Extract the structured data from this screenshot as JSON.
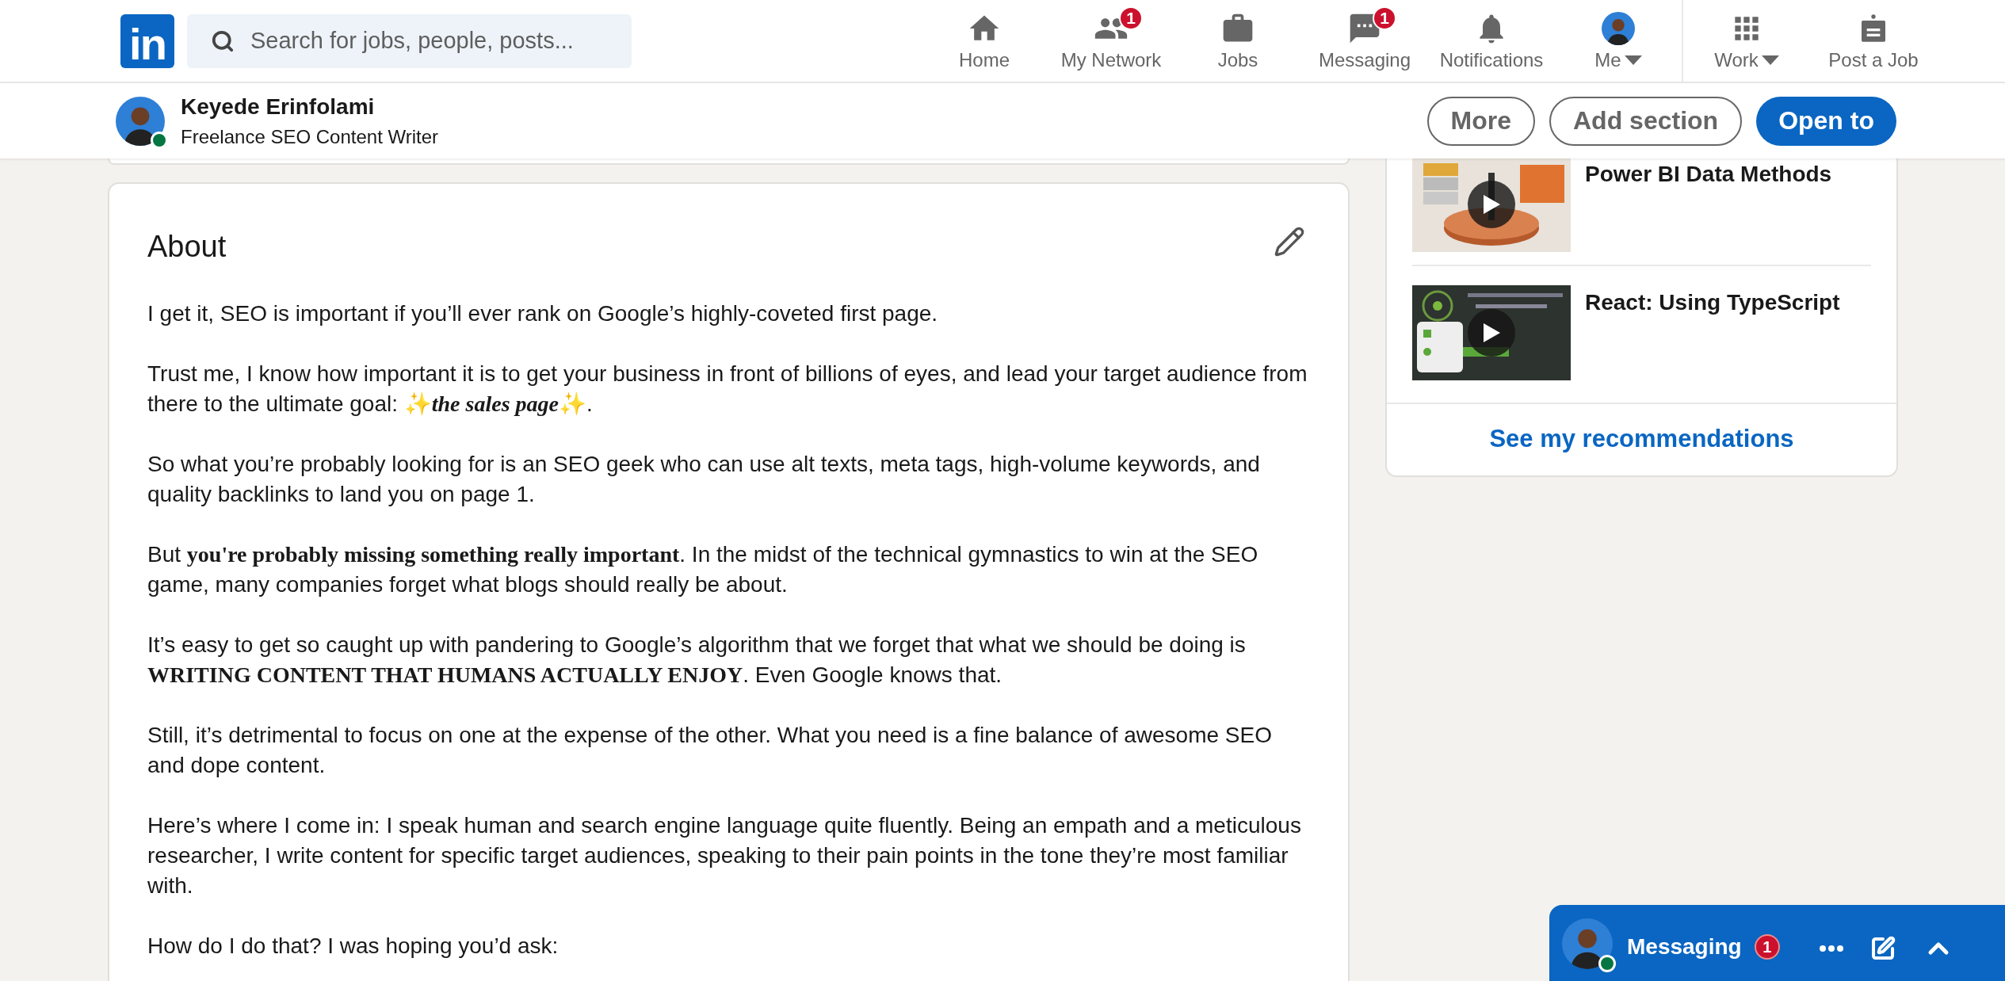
{
  "nav": {
    "logo": "in",
    "search": {
      "placeholder": "Search for jobs, people, posts..."
    },
    "items": [
      {
        "kind": "home",
        "label": "Home",
        "dropdown": false
      },
      {
        "kind": "network",
        "label": "My Network",
        "badge": "1",
        "dropdown": false
      },
      {
        "kind": "jobs",
        "label": "Jobs",
        "dropdown": false
      },
      {
        "kind": "messaging",
        "label": "Messaging",
        "badge": "1",
        "dropdown": false
      },
      {
        "kind": "notifications",
        "label": "Notifications",
        "dropdown": false
      },
      {
        "kind": "me",
        "label": "Me",
        "dropdown": true
      },
      {
        "kind": "work",
        "label": "Work",
        "dropdown": true
      },
      {
        "kind": "post",
        "label": "Post a Job",
        "dropdown": false
      }
    ]
  },
  "profile_bar": {
    "name": "Keyede Erinfolami",
    "headline": "Freelance SEO Content Writer",
    "online": true,
    "buttons": [
      {
        "label": "More",
        "kind": "outline"
      },
      {
        "label": "Add section",
        "kind": "outline"
      },
      {
        "label": "Open to",
        "kind": "primary"
      }
    ]
  },
  "about": {
    "title": "About",
    "paragraphs": [
      "I get it, SEO is important if you’ll ever rank on Google’s highly-coveted first page.",
      "Trust me, I know how important it is to get your business in front of billions of eyes, and lead your target audience from there to the ultimate goal: ✨*the sales page*✨.",
      "So what you’re probably looking for is an SEO geek who can use alt texts, meta tags, high-volume keywords, and quality backlinks to land you on page 1.",
      "But **you're probably missing something really important**. In the midst of the technical gymnastics to win at the SEO game, many companies forget what blogs should really be about.",
      "It’s easy to get so caught up with pandering to Google’s algorithm that we forget that what we should be doing is **WRITING CONTENT THAT HUMANS ACTUALLY ENJOY**. Even Google knows that.",
      "Still, it’s detrimental to focus on one at the expense of the other. What you need is a fine balance of awesome SEO and dope content.",
      "Here’s where I come in: I speak human and search engine language quite fluently. Being an empath and a meticulous researcher, I write content for specific target audiences, speaking to their pain points in the tone they’re most familiar with.",
      "How do I do that? I was hoping you’d ask:"
    ]
  },
  "courses": {
    "items": [
      {
        "title": "Power BI Data Methods",
        "kind": "chart"
      },
      {
        "title": "React: Using TypeScript",
        "kind": "code"
      }
    ],
    "link": "See my recommendations"
  },
  "messaging": {
    "label": "Messaging",
    "badge": "1",
    "online": true
  }
}
